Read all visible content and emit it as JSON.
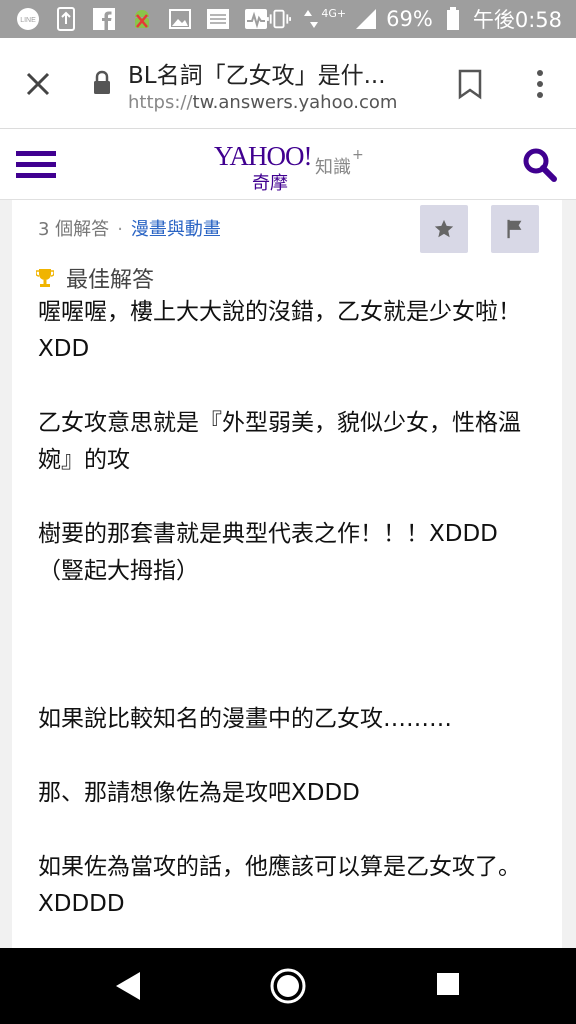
{
  "status_bar": {
    "icons": [
      "line-icon",
      "upload-icon",
      "facebook-icon",
      "android-debug-icon",
      "image-icon",
      "calendar-icon",
      "activity-icon",
      "vibrate-icon",
      "data-icon",
      "signal-icon",
      "battery-icon"
    ],
    "network": "4G+",
    "battery": "69%",
    "time": "午後0:58"
  },
  "browser": {
    "title": "BL名詞「乙女攻」是什...",
    "url_scheme": "https://",
    "url_host": "tw.answers.yahoo.com"
  },
  "header": {
    "logo_main": "YAHOO!",
    "logo_sub": "奇摩",
    "logo_product": "知識",
    "logo_plus": "+"
  },
  "answer_meta": {
    "count": "3 個解答",
    "separator": "·",
    "category": "漫畫與動畫"
  },
  "best_answer": {
    "label": "最佳解答",
    "paragraphs": [
      "喔喔喔，樓上大大說的沒錯，乙女就是少女啦！XDD",
      "乙女攻意思就是『外型弱美，貌似少女，性格溫婉』的攻",
      "樹要的那套書就是典型代表之作！！！XDDD（豎起大拇指）",
      "如果說比較知名的漫畫中的乙女攻………",
      "那、那請想像佐為是攻吧XDDD",
      "如果佐為當攻的話，他應該可以算是乙女攻了。XDDDD"
    ]
  },
  "colors": {
    "brand_purple": "#400090",
    "link_blue": "#2a64c4",
    "button_bg": "#d8d8e6",
    "trophy_gold": "#f0b400"
  }
}
